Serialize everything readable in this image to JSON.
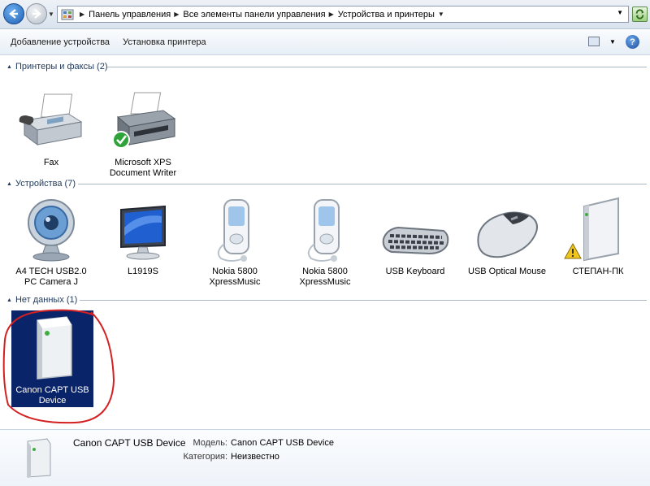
{
  "address": {
    "breadcrumbs": [
      "Панель управления",
      "Все элементы панели управления",
      "Устройства и принтеры"
    ]
  },
  "commands": {
    "add_device": "Добавление устройства",
    "add_printer": "Установка принтера"
  },
  "groups": {
    "printers": {
      "title": "Принтеры и факсы (2)",
      "items": [
        {
          "label": "Fax"
        },
        {
          "label": "Microsoft XPS Document Writer"
        }
      ]
    },
    "devices": {
      "title": "Устройства (7)",
      "items": [
        {
          "label": "A4 TECH USB2.0 PC Camera J"
        },
        {
          "label": "L1919S"
        },
        {
          "label": "Nokia 5800 XpressMusic"
        },
        {
          "label": "Nokia 5800 XpressMusic"
        },
        {
          "label": "USB Keyboard"
        },
        {
          "label": "USB Optical Mouse"
        },
        {
          "label": "СТЕПАН-ПК"
        }
      ]
    },
    "nodata": {
      "title": "Нет данных (1)",
      "items": [
        {
          "label": "Canon CAPT USB Device"
        }
      ]
    }
  },
  "details": {
    "name": "Canon CAPT USB Device",
    "model_key": "Модель:",
    "model_val": "Canon CAPT USB Device",
    "category_key": "Категория:",
    "category_val": "Неизвестно"
  },
  "colors": {
    "selection": "#0a246a",
    "annotation": "#d42020",
    "group_text": "#1e395b"
  }
}
